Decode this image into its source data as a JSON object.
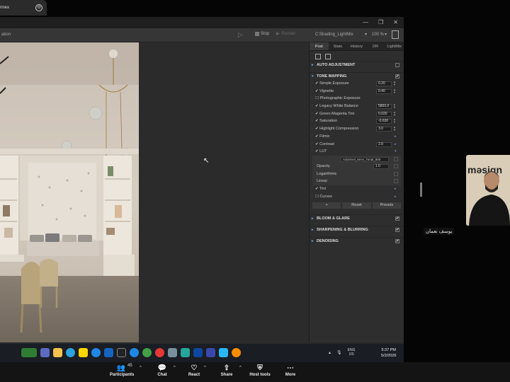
{
  "top": {
    "tab_title": "nnex",
    "close_glyph": "⊖"
  },
  "window": {
    "controls": [
      "—",
      "❐",
      "✕"
    ],
    "toolbar": {
      "left_label": "ation",
      "play_suffix": "▷",
      "stop_label": "Stop",
      "render_label": "Render",
      "preset": "C:Shading_LightMix",
      "zoom": "100 %"
    }
  },
  "panel": {
    "tabs": [
      "Post",
      "Stats",
      "History",
      "DR",
      "LightMix"
    ],
    "active_tab": "Post",
    "sections": {
      "auto": "AUTO ADJUSTMENT",
      "tone": "TONE MAPPING",
      "bloom": "BLOOM & GLARE",
      "sharpening": "SHARPENING & BLURRING",
      "denoising": "DENOISING"
    },
    "tone_rows": [
      {
        "label": "✔ Simple Exposure",
        "value": "0.20"
      },
      {
        "label": "✔ Vignette",
        "value": "0.40"
      },
      {
        "label": "☐ Photographic Exposure",
        "value": ""
      },
      {
        "label": "✔ Legacy White Balance",
        "value": "5800.0"
      },
      {
        "label": "✔ Green-Magenta Tint",
        "value": "0.020"
      },
      {
        "label": "✔ Saturation",
        "value": "-0.630"
      },
      {
        "label": "✔ Highlight Compression",
        "value": "3.0"
      },
      {
        "label": "✔ Filmic",
        "value": ""
      },
      {
        "label": "✔ Contrast",
        "value": "2.0"
      },
      {
        "label": "✔ LUT",
        "value": ""
      }
    ],
    "lut": {
      "file": "Adorimel_MAX_Tonal_800",
      "opacity_label": "Opacity",
      "opacity_value": "1.0",
      "log_label": "Logarithmic",
      "linear_label": "Linear"
    },
    "after_rows": [
      {
        "label": "✔ Tint"
      },
      {
        "label": "☐ Curves"
      }
    ],
    "buttons": [
      "+",
      "Reset",
      "Presets"
    ]
  },
  "participant": {
    "name": "يوسف نعمان",
    "shirt_text": "məsign"
  },
  "taskbar": {
    "lang": "ENG",
    "lang_sub": "US",
    "time": "5:37 PM",
    "date": "5/2/2026"
  },
  "zoom_toolbar": {
    "participants_label": "Participants",
    "participants_count": "45",
    "chat_label": "Chat",
    "react_label": "React",
    "share_label": "Share",
    "host_label": "Host tools",
    "more_label": "More"
  }
}
